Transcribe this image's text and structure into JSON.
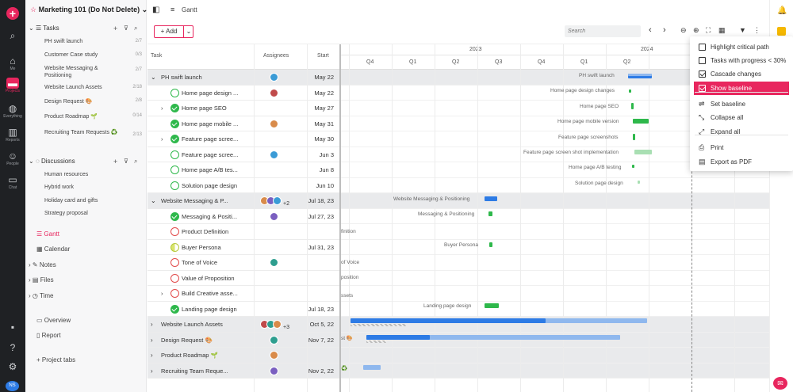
{
  "rail": {
    "items": [
      {
        "icon": "search-icon",
        "label": ""
      },
      {
        "icon": "home-icon",
        "label": "Me"
      },
      {
        "icon": "folder-icon",
        "label": "Projects"
      },
      {
        "icon": "globe-icon",
        "label": "Everything"
      },
      {
        "icon": "bar-chart-icon",
        "label": "Reports"
      },
      {
        "icon": "people-icon",
        "label": "People"
      },
      {
        "icon": "chat-icon",
        "label": "Chat"
      }
    ],
    "avatar_initials": "NS"
  },
  "sidebar": {
    "project_title": "Marketing 101 (Do Not Delete)",
    "tasks_label": "Tasks",
    "task_lists": [
      {
        "name": "PH swift launch",
        "count": "2/7"
      },
      {
        "name": "Customer Case study",
        "count": "0/3"
      },
      {
        "name": "Website Messaging & Positioning",
        "count": "2/7"
      },
      {
        "name": "Website Launch Assets",
        "count": "2/18"
      },
      {
        "name": "Design Request 🎨",
        "count": "2/8"
      },
      {
        "name": "Product Roadmap 🌱",
        "count": "0/14"
      },
      {
        "name": "Recruiting Team Requests ♻️",
        "count": "2/13"
      }
    ],
    "discussions_label": "Discussions",
    "discussions": [
      "Human resources",
      "Hybrid work",
      "Holiday card and gifts",
      "Strategy proposal"
    ],
    "views": [
      "Gantt",
      "Calendar",
      "Notes",
      "Files",
      "Time"
    ],
    "extra": [
      "Overview",
      "Report"
    ],
    "project_tabs": "Project tabs"
  },
  "topbar": {
    "view_title": "Gantt"
  },
  "toolbar": {
    "add_label": "Add",
    "search_placeholder": "Search"
  },
  "grid": {
    "headers": {
      "task": "Task",
      "assignees": "Assignees",
      "start": "Start"
    },
    "rows": [
      {
        "name": "PH swift launch",
        "start": "May 22",
        "type": "group",
        "expanded": true
      },
      {
        "name": "Home page design ...",
        "start": "May 22",
        "status": "open-green"
      },
      {
        "name": "Home page SEO",
        "start": "May 27",
        "status": "done",
        "expandable": true
      },
      {
        "name": "Home page mobile ...",
        "start": "May 31",
        "status": "done"
      },
      {
        "name": "Feature page scree...",
        "start": "May 30",
        "status": "done",
        "expandable": true
      },
      {
        "name": "Feature page scree...",
        "start": "Jun 3",
        "status": "open-green"
      },
      {
        "name": "Home page A/B tes...",
        "start": "Jun 8",
        "status": "open-green"
      },
      {
        "name": "Solution page design",
        "start": "Jun 10",
        "status": "open-green"
      },
      {
        "name": "Website Messaging & P...",
        "start": "Jul 18, 23",
        "type": "group",
        "expanded": true,
        "extra_assignees": "+2"
      },
      {
        "name": "Messaging & Positi...",
        "start": "Jul 27, 23",
        "status": "done"
      },
      {
        "name": "Product Definition",
        "start": "",
        "status": "open-red"
      },
      {
        "name": "Buyer Persona",
        "start": "Jul 31, 23",
        "status": "half"
      },
      {
        "name": "Tone of Voice",
        "start": "",
        "status": "open-red"
      },
      {
        "name": "Value of Proposition",
        "start": "",
        "status": "open-red"
      },
      {
        "name": "Build Creative asse...",
        "start": "",
        "status": "open-red",
        "expandable": true
      },
      {
        "name": "Landing page design",
        "start": "Jul 18, 23",
        "status": "done"
      },
      {
        "name": "Website Launch Assets",
        "start": "Oct 5, 22",
        "type": "group",
        "extra_assignees": "+3"
      },
      {
        "name": "Design Request 🎨",
        "start": "Nov 7, 22",
        "type": "group"
      },
      {
        "name": "Product Roadmap 🌱",
        "start": "",
        "type": "group"
      },
      {
        "name": "Recruiting Team Reque...",
        "start": "Nov 2, 22",
        "type": "group"
      }
    ]
  },
  "timeline": {
    "years": [
      "2023",
      "2024"
    ],
    "quarters": [
      "Q4",
      "Q1",
      "Q2",
      "Q3",
      "Q4",
      "Q1",
      "Q2"
    ],
    "bar_labels": [
      "PH swift launch",
      "Home page design changes",
      "Home page SEO",
      "Home page mobile version",
      "Feature page screenshots",
      "Feature page screen shot implementation",
      "Home page A/B testing",
      "Solution page design",
      "Website Messaging & Positioning",
      "Messaging & Positioning",
      "Buyer Persona",
      "Landing page design"
    ],
    "clipped_labels": [
      "finition",
      "of Voice",
      "position",
      "ssets",
      "st 🎨",
      "♻️"
    ]
  },
  "menu": {
    "items": [
      {
        "label": "Highlight critical path",
        "kind": "check",
        "checked": false
      },
      {
        "label": "Tasks with progress < 30%",
        "kind": "check",
        "checked": false
      },
      {
        "label": "Cascade changes",
        "kind": "check",
        "checked": true
      },
      {
        "label": "Show baseline",
        "kind": "check",
        "checked": true,
        "active": true
      },
      {
        "label": "Set baseline",
        "kind": "icon",
        "icon": "baseline-icon"
      },
      {
        "label": "Collapse all",
        "kind": "icon",
        "icon": "collapse-icon"
      },
      {
        "label": "Expand all",
        "kind": "icon",
        "icon": "expand-icon"
      },
      {
        "label": "Print",
        "kind": "icon",
        "icon": "print-icon"
      },
      {
        "label": "Export as PDF",
        "kind": "icon",
        "icon": "pdf-icon"
      }
    ]
  },
  "colors": {
    "accent": "#e8265e",
    "done": "#2eb84b",
    "bar_blue": "#2d7be5",
    "bar_light": "#8fb8ee"
  }
}
